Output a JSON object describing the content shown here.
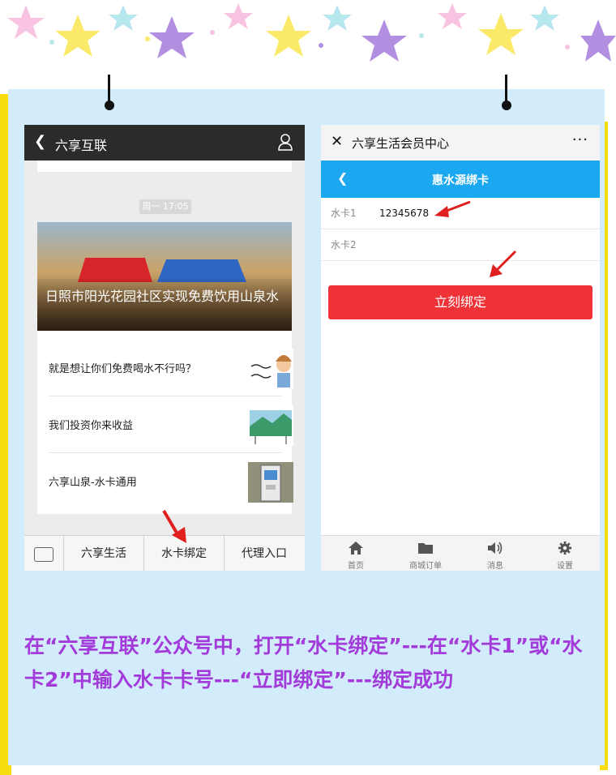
{
  "colors": {
    "caption": "#a23bd9",
    "accent_blue": "#1ba8f0",
    "bind_red": "#ee3237",
    "card_bg": "#d3ecfb",
    "side_bar_yellow": "#f7dd0f"
  },
  "left_phone": {
    "header": {
      "back_icon": "chevron-left-icon",
      "title": "六享互联",
      "user_icon": "person-icon"
    },
    "timestamp": "周一 17:05",
    "news": {
      "hero_title": "日照市阳光花园社区实现免费饮用山泉水",
      "items": [
        {
          "title": "就是想让你们免费喝水不行吗？"
        },
        {
          "title": "我们投资你来收益"
        },
        {
          "title": "六享山泉-水卡通用"
        }
      ]
    },
    "menu": {
      "keyboard_icon": "keyboard-icon",
      "items": [
        "六享生活",
        "水卡绑定",
        "代理入口"
      ]
    }
  },
  "right_phone": {
    "header": {
      "close_icon": "close-icon",
      "title": "六享生活会员中心",
      "more_label": "···"
    },
    "bar": {
      "back_icon": "chevron-left-icon",
      "title": "惠水源绑卡"
    },
    "fields": [
      {
        "label": "水卡1",
        "value": "12345678"
      },
      {
        "label": "水卡2",
        "value": ""
      }
    ],
    "bind_button": "立刻绑定",
    "tabs": [
      {
        "icon": "home-icon",
        "label": "首页"
      },
      {
        "icon": "folder-icon",
        "label": "商城订单"
      },
      {
        "icon": "speaker-icon",
        "label": "消息"
      },
      {
        "icon": "gear-icon",
        "label": "设置"
      }
    ]
  },
  "caption": "在“六享互联”公众号中，打开“水卡绑定”---在“水卡1”或“水卡2”中输入水卡卡号---“立即绑定”---绑定成功"
}
